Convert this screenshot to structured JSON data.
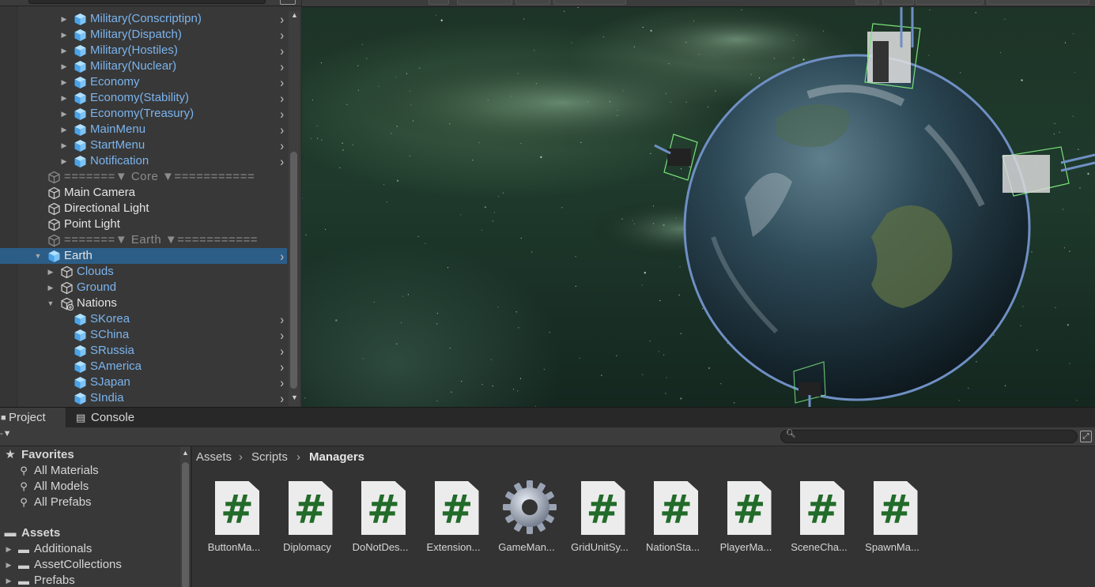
{
  "hierarchy": {
    "rows": [
      {
        "label": "Military(Conscriptipn)",
        "style": "blue",
        "indent": 1,
        "arrow": "right",
        "chevron": true,
        "icon": "prefab-cube-icon"
      },
      {
        "label": "Military(Dispatch)",
        "style": "blue",
        "indent": 1,
        "arrow": "right",
        "chevron": true,
        "icon": "prefab-cube-icon"
      },
      {
        "label": "Military(Hostiles)",
        "style": "blue",
        "indent": 1,
        "arrow": "right",
        "chevron": true,
        "icon": "prefab-cube-icon"
      },
      {
        "label": "Military(Nuclear)",
        "style": "blue",
        "indent": 1,
        "arrow": "right",
        "chevron": true,
        "icon": "prefab-cube-icon"
      },
      {
        "label": "Economy",
        "style": "blue",
        "indent": 1,
        "arrow": "right",
        "chevron": true,
        "icon": "prefab-cube-icon"
      },
      {
        "label": "Economy(Stability)",
        "style": "blue",
        "indent": 1,
        "arrow": "right",
        "chevron": true,
        "icon": "prefab-cube-icon"
      },
      {
        "label": "Economy(Treasury)",
        "style": "blue",
        "indent": 1,
        "arrow": "right",
        "chevron": true,
        "icon": "prefab-cube-icon"
      },
      {
        "label": "MainMenu",
        "style": "blue",
        "indent": 1,
        "arrow": "right",
        "chevron": true,
        "icon": "prefab-cube-icon"
      },
      {
        "label": "StartMenu",
        "style": "blue",
        "indent": 1,
        "arrow": "right",
        "chevron": true,
        "icon": "prefab-cube-icon"
      },
      {
        "label": "Notification",
        "style": "blue",
        "indent": 1,
        "arrow": "right",
        "chevron": true,
        "icon": "prefab-cube-icon"
      },
      {
        "label": "=======▼ Core ▼===========",
        "style": "sep",
        "indent": 0,
        "arrow": "",
        "chevron": false,
        "icon": "gameobject-cube-icon"
      },
      {
        "label": "Main Camera",
        "style": "white",
        "indent": 0,
        "arrow": "",
        "chevron": false,
        "icon": "gameobject-cube-icon"
      },
      {
        "label": "Directional Light",
        "style": "white",
        "indent": 0,
        "arrow": "",
        "chevron": false,
        "icon": "gameobject-cube-icon"
      },
      {
        "label": "Point Light",
        "style": "white",
        "indent": 0,
        "arrow": "",
        "chevron": false,
        "icon": "gameobject-cube-icon"
      },
      {
        "label": "=======▼ Earth ▼===========",
        "style": "sep",
        "indent": 0,
        "arrow": "",
        "chevron": false,
        "icon": "gameobject-cube-icon"
      },
      {
        "label": "Earth",
        "style": "white",
        "indent": 0,
        "arrow": "down",
        "chevron": true,
        "icon": "prefab-cube-icon",
        "selected": true
      },
      {
        "label": "Clouds",
        "style": "blue",
        "indent": 1,
        "arrow": "right",
        "chevron": false,
        "icon": "gameobject-cube-icon"
      },
      {
        "label": "Ground",
        "style": "blue",
        "indent": 1,
        "arrow": "right",
        "chevron": false,
        "icon": "gameobject-cube-icon"
      },
      {
        "label": "Nations",
        "style": "white",
        "indent": 1,
        "arrow": "down",
        "chevron": false,
        "icon": "gameobject-added-icon"
      },
      {
        "label": "SKorea",
        "style": "blue",
        "indent": 2,
        "arrow": "",
        "chevron": true,
        "icon": "prefab-cube-icon"
      },
      {
        "label": "SChina",
        "style": "blue",
        "indent": 2,
        "arrow": "",
        "chevron": true,
        "icon": "prefab-cube-icon"
      },
      {
        "label": "SRussia",
        "style": "blue",
        "indent": 2,
        "arrow": "",
        "chevron": true,
        "icon": "prefab-cube-icon"
      },
      {
        "label": "SAmerica",
        "style": "blue",
        "indent": 2,
        "arrow": "",
        "chevron": true,
        "icon": "prefab-cube-icon"
      },
      {
        "label": "SJapan",
        "style": "blue",
        "indent": 2,
        "arrow": "",
        "chevron": true,
        "icon": "prefab-cube-icon"
      },
      {
        "label": "SIndia",
        "style": "blue",
        "indent": 2,
        "arrow": "",
        "chevron": true,
        "icon": "prefab-cube-icon"
      }
    ]
  },
  "tabs": {
    "project": "Project",
    "console": "Console"
  },
  "sidebar": {
    "favorites_label": "Favorites",
    "favorites": [
      "All Materials",
      "All Models",
      "All Prefabs"
    ],
    "assets_label": "Assets",
    "folders": [
      "Additionals",
      "AssetCollections",
      "Prefabs"
    ]
  },
  "breadcrumb": {
    "items": [
      "Assets",
      "Scripts",
      "Managers"
    ]
  },
  "assets": [
    {
      "name": "ButtonMa...",
      "kind": "script"
    },
    {
      "name": "Diplomacy",
      "kind": "script"
    },
    {
      "name": "DoNotDes...",
      "kind": "script"
    },
    {
      "name": "Extension...",
      "kind": "script"
    },
    {
      "name": "GameMan...",
      "kind": "gear"
    },
    {
      "name": "GridUnitSy...",
      "kind": "script"
    },
    {
      "name": "NationSta...",
      "kind": "script"
    },
    {
      "name": "PlayerMa...",
      "kind": "script"
    },
    {
      "name": "SceneCha...",
      "kind": "script"
    },
    {
      "name": "SpawnMa...",
      "kind": "script"
    }
  ],
  "colors": {
    "selection": "#2c5d87",
    "prefab_blue": "#7bb4ee",
    "script_hash": "#226b2a"
  }
}
